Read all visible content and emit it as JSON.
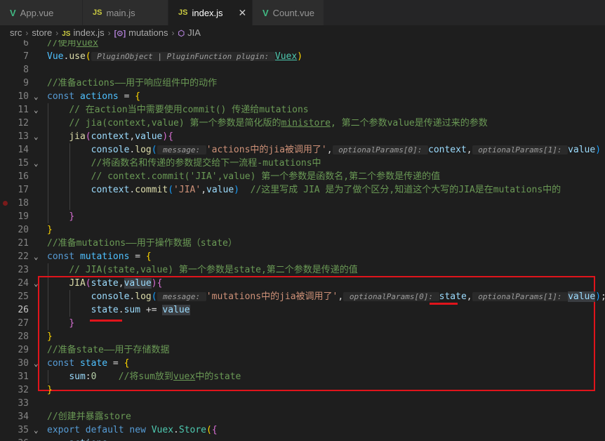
{
  "tabs": [
    {
      "icon": "vue-icon",
      "icon_text": "V",
      "label": "App.vue",
      "active": false
    },
    {
      "icon": "js-icon",
      "icon_text": "JS",
      "label": "main.js",
      "active": false
    },
    {
      "icon": "js-icon",
      "icon_text": "JS",
      "label": "index.js",
      "active": true,
      "close": "✕"
    },
    {
      "icon": "vue-icon",
      "icon_text": "V",
      "label": "Count.vue",
      "active": false
    }
  ],
  "breadcrumb": {
    "items": [
      {
        "label": "src"
      },
      {
        "label": "store"
      },
      {
        "label": "index.js",
        "icon": "js-icon",
        "icon_text": "JS"
      },
      {
        "label": "mutations",
        "icon": "symbol-variable-icon",
        "icon_text": "[⊙]"
      },
      {
        "label": "JIA",
        "icon": "symbol-method-icon",
        "icon_text": "⬡"
      }
    ],
    "separator": "›"
  },
  "editor": {
    "fold_chevron": "⌄",
    "current_line": 26,
    "breakpoint_line": 18,
    "lines": [
      {
        "n": 6,
        "t": [
          [
            "comment",
            "//使用"
          ],
          [
            "comment-u",
            "vuex"
          ]
        ]
      },
      {
        "n": 7,
        "t": [
          [
            "const",
            "Vue"
          ],
          [
            "p",
            "."
          ],
          [
            "fn",
            "use"
          ],
          [
            "b1",
            "("
          ],
          [
            "hint",
            " PluginObject | PluginFunction plugin: "
          ],
          [
            "class-u",
            "Vuex"
          ],
          [
            "b1",
            ")"
          ]
        ]
      },
      {
        "n": 8,
        "t": []
      },
      {
        "n": 9,
        "t": [
          [
            "comment",
            "//准备actions——用于响应组件中的动作"
          ]
        ]
      },
      {
        "n": 10,
        "fold": true,
        "t": [
          [
            "keyword",
            "const "
          ],
          [
            "const",
            "actions"
          ],
          [
            "p",
            " = "
          ],
          [
            "b1",
            "{"
          ]
        ]
      },
      {
        "n": 11,
        "fold": true,
        "t": [
          [
            "p",
            "    "
          ],
          [
            "comment",
            "// 在action当中需要使用commit() 传递给mutations"
          ]
        ]
      },
      {
        "n": 12,
        "t": [
          [
            "p",
            "    "
          ],
          [
            "comment",
            "// jia(context,value) 第一个参数是简化版的"
          ],
          [
            "comment-u",
            "ministore"
          ],
          [
            "comment",
            ", 第二个参数value是传递过来的参数"
          ]
        ]
      },
      {
        "n": 13,
        "fold": true,
        "t": [
          [
            "p",
            "    "
          ],
          [
            "fn",
            "jia"
          ],
          [
            "b2",
            "("
          ],
          [
            "var",
            "context"
          ],
          [
            "p",
            ","
          ],
          [
            "var",
            "value"
          ],
          [
            "b2",
            ")"
          ],
          [
            "b2",
            "{"
          ]
        ]
      },
      {
        "n": 14,
        "t": [
          [
            "p",
            "        "
          ],
          [
            "var",
            "console"
          ],
          [
            "p",
            "."
          ],
          [
            "fn",
            "log"
          ],
          [
            "b3",
            "("
          ],
          [
            "hint",
            " message: "
          ],
          [
            "string",
            "'actions中的jia被调用了'"
          ],
          [
            "p",
            ","
          ],
          [
            "hint",
            " optionalParams[0]: "
          ],
          [
            "var",
            "context"
          ],
          [
            "p",
            ","
          ],
          [
            "hint",
            " optionalParams[1]: "
          ],
          [
            "var",
            "value"
          ],
          [
            "b3",
            ")"
          ]
        ]
      },
      {
        "n": 15,
        "fold": true,
        "t": [
          [
            "p",
            "        "
          ],
          [
            "comment",
            "//将函数名和传递的参数提交给下一流程-mutations中"
          ]
        ]
      },
      {
        "n": 16,
        "t": [
          [
            "p",
            "        "
          ],
          [
            "comment",
            "// context.commit('JIA',value) 第一个参数是函数名,第二个参数是传递的值"
          ]
        ]
      },
      {
        "n": 17,
        "t": [
          [
            "p",
            "        "
          ],
          [
            "var",
            "context"
          ],
          [
            "p",
            "."
          ],
          [
            "fn",
            "commit"
          ],
          [
            "b3",
            "("
          ],
          [
            "string",
            "'JIA'"
          ],
          [
            "p",
            ","
          ],
          [
            "var",
            "value"
          ],
          [
            "b3",
            ")"
          ],
          [
            "p",
            "  "
          ],
          [
            "comment",
            "//这里写成 JIA 是为了做个区分,知道这个大写的JIA是在mutations中的"
          ]
        ]
      },
      {
        "n": 18,
        "t": []
      },
      {
        "n": 19,
        "t": [
          [
            "p",
            "    "
          ],
          [
            "b2",
            "}"
          ]
        ]
      },
      {
        "n": 20,
        "t": [
          [
            "b1",
            "}"
          ]
        ]
      },
      {
        "n": 21,
        "t": [
          [
            "comment",
            "//准备mutations——用于操作数据（state）"
          ]
        ]
      },
      {
        "n": 22,
        "fold": true,
        "t": [
          [
            "keyword",
            "const "
          ],
          [
            "const",
            "mutations"
          ],
          [
            "p",
            " = "
          ],
          [
            "b1",
            "{"
          ]
        ]
      },
      {
        "n": 23,
        "t": [
          [
            "p",
            "    "
          ],
          [
            "comment",
            "// JIA(state,value) 第一个参数是state,第二个参数是传递的值"
          ]
        ]
      },
      {
        "n": 24,
        "fold": true,
        "t": [
          [
            "p",
            "    "
          ],
          [
            "fn",
            "JIA"
          ],
          [
            "b2",
            "("
          ],
          [
            "var",
            "state"
          ],
          [
            "p",
            ","
          ],
          [
            "var-hl",
            "value"
          ],
          [
            "b2",
            ")"
          ],
          [
            "b2",
            "{"
          ]
        ]
      },
      {
        "n": 25,
        "t": [
          [
            "p",
            "        "
          ],
          [
            "var",
            "console"
          ],
          [
            "p",
            "."
          ],
          [
            "fn",
            "log"
          ],
          [
            "b3",
            "("
          ],
          [
            "hint",
            " message: "
          ],
          [
            "string",
            "'mutations中的jia被调用了'"
          ],
          [
            "p",
            ","
          ],
          [
            "hint",
            " optionalParams[0]: "
          ],
          [
            "var",
            "state"
          ],
          [
            "p",
            ","
          ],
          [
            "hint",
            " optionalParams[1]: "
          ],
          [
            "var-hl",
            "value"
          ],
          [
            "b3",
            ")"
          ],
          [
            "p",
            ";"
          ]
        ]
      },
      {
        "n": 26,
        "t": [
          [
            "p",
            "        "
          ],
          [
            "var",
            "state"
          ],
          [
            "p",
            "."
          ],
          [
            "var",
            "sum"
          ],
          [
            "p",
            " += "
          ],
          [
            "var-hl",
            "value"
          ]
        ]
      },
      {
        "n": 27,
        "t": [
          [
            "p",
            "    "
          ],
          [
            "b2",
            "}"
          ]
        ]
      },
      {
        "n": 28,
        "t": [
          [
            "b1",
            "}"
          ]
        ]
      },
      {
        "n": 29,
        "t": [
          [
            "comment",
            "//准备state——用于存储数据"
          ]
        ]
      },
      {
        "n": 30,
        "fold": true,
        "t": [
          [
            "keyword",
            "const "
          ],
          [
            "const",
            "state"
          ],
          [
            "p",
            " = "
          ],
          [
            "b1",
            "{"
          ]
        ]
      },
      {
        "n": 31,
        "t": [
          [
            "p",
            "    "
          ],
          [
            "var",
            "sum"
          ],
          [
            "p",
            ":"
          ],
          [
            "number",
            "0"
          ],
          [
            "p",
            "    "
          ],
          [
            "comment",
            "//将sum放到"
          ],
          [
            "comment-u",
            "vuex"
          ],
          [
            "comment",
            "中的state"
          ]
        ]
      },
      {
        "n": 32,
        "t": [
          [
            "b1",
            "}"
          ]
        ]
      },
      {
        "n": 33,
        "t": []
      },
      {
        "n": 34,
        "t": [
          [
            "comment",
            "//创建并暴露store"
          ]
        ]
      },
      {
        "n": 35,
        "fold": true,
        "t": [
          [
            "keyword",
            "export "
          ],
          [
            "keyword",
            "default "
          ],
          [
            "keyword",
            "new "
          ],
          [
            "class",
            "Vuex"
          ],
          [
            "p",
            "."
          ],
          [
            "class",
            "Store"
          ],
          [
            "b1",
            "("
          ],
          [
            "b2",
            "{"
          ]
        ]
      },
      {
        "n": 36,
        "t": [
          [
            "p",
            "    "
          ],
          [
            "var",
            "actions"
          ],
          [
            "p",
            ","
          ]
        ]
      }
    ]
  }
}
